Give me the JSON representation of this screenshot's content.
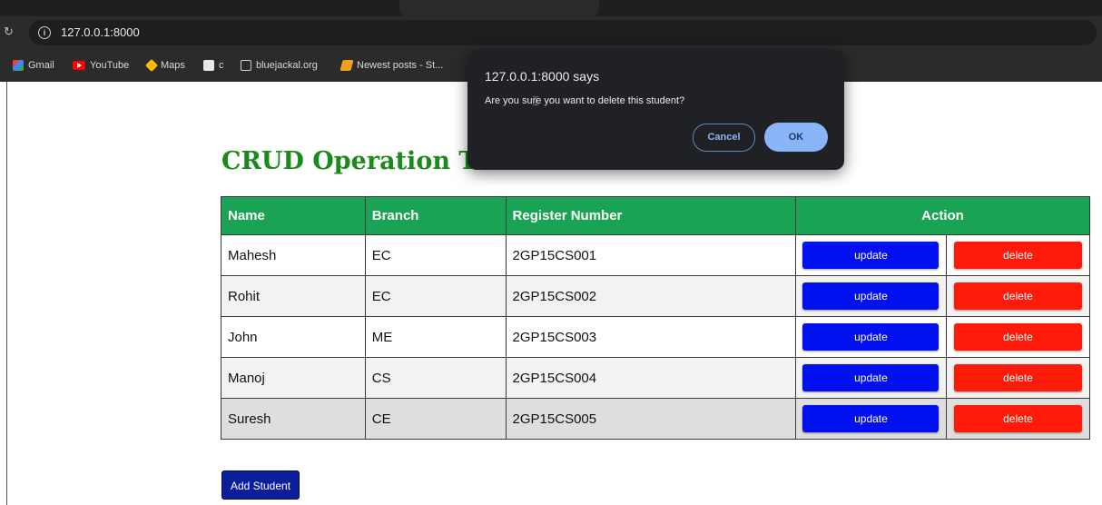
{
  "browser": {
    "url": "127.0.0.1:8000",
    "bookmarks": [
      {
        "label": "Gmail",
        "icon": "gmail-icon"
      },
      {
        "label": "YouTube",
        "icon": "youtube-icon"
      },
      {
        "label": "Maps",
        "icon": "maps-icon"
      },
      {
        "label": "c",
        "icon": "cube-icon"
      },
      {
        "label": "bluejackal.org",
        "icon": "globe-icon"
      },
      {
        "label": "Newest posts - St...",
        "icon": "stackoverflow-icon"
      }
    ]
  },
  "page": {
    "title": "CRUD Operation Table",
    "table": {
      "headers": {
        "name": "Name",
        "branch": "Branch",
        "register": "Register Number",
        "action": "Action"
      },
      "rows": [
        {
          "name": "Mahesh",
          "branch": "EC",
          "register": "2GP15CS001",
          "update": "update",
          "delete": "delete"
        },
        {
          "name": "Rohit",
          "branch": "EC",
          "register": "2GP15CS002",
          "update": "update",
          "delete": "delete"
        },
        {
          "name": "John",
          "branch": "ME",
          "register": "2GP15CS003",
          "update": "update",
          "delete": "delete"
        },
        {
          "name": "Manoj",
          "branch": "CS",
          "register": "2GP15CS004",
          "update": "update",
          "delete": "delete"
        },
        {
          "name": "Suresh",
          "branch": "CE",
          "register": "2GP15CS005",
          "update": "update",
          "delete": "delete"
        }
      ]
    },
    "add_button": "Add Student"
  },
  "dialog": {
    "title": "127.0.0.1:8000 says",
    "message": "Are you sure you want to delete this student?",
    "cancel": "Cancel",
    "ok": "OK"
  },
  "colors": {
    "header_green": "#1aa355",
    "title_green": "#1a8a1a",
    "update_blue": "#0010ee",
    "delete_red": "#ff1a0a",
    "add_button_blue": "#0b1f9a",
    "dialog_bg": "#202124",
    "ok_blue": "#8ab4f8"
  }
}
